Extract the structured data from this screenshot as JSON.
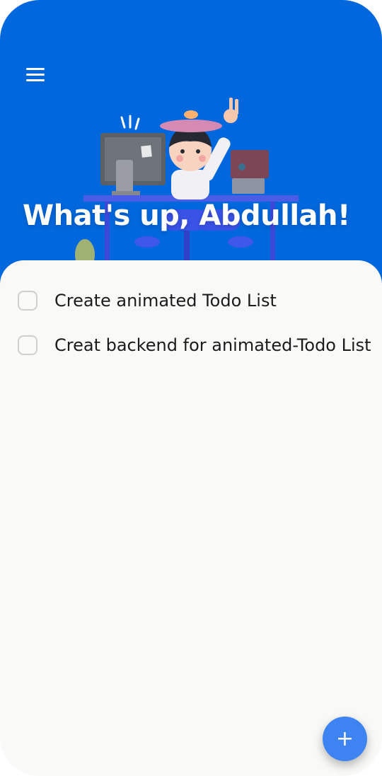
{
  "header": {
    "menu_icon": "hamburger-menu-icon",
    "illustration": "person-at-desk-illustration",
    "greeting": "What's up, Abdullah!"
  },
  "todos": [
    {
      "text": "Create animated Todo List",
      "checked": false
    },
    {
      "text": "Creat backend for animated-Todo List",
      "checked": false
    }
  ],
  "fab": {
    "icon": "plus-icon",
    "label": "+"
  },
  "colors": {
    "header_bg": "#0067dc",
    "sheet_bg": "#f9f9f7",
    "fab_bg": "#3d84f2",
    "checkbox_border": "#cfcfcf"
  }
}
